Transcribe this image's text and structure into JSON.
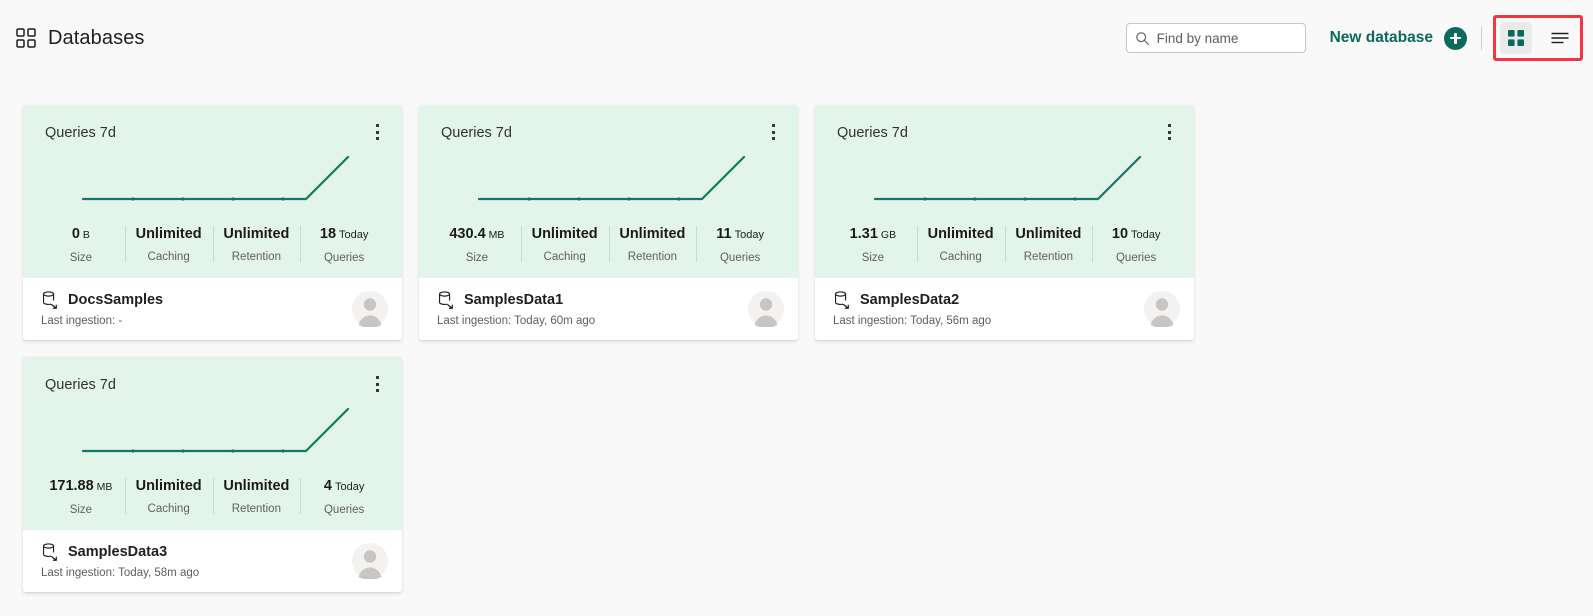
{
  "header": {
    "title": "Databases",
    "title_icon": "grid-apps-icon",
    "search": {
      "placeholder": "Find by name",
      "value": "",
      "icon": "search-icon"
    },
    "new_database": {
      "label": "New database",
      "icon": "plus-circle-icon"
    },
    "view_toggle": {
      "grid": {
        "icon": "grid-view-icon",
        "active": true
      },
      "list": {
        "icon": "list-view-icon",
        "active": false
      },
      "highlight_color": "#f4343e"
    }
  },
  "colors": {
    "accent_green": "#0b6a5b",
    "card_top_bg": "#e3f5ea",
    "spark_line": "#0f7a63",
    "page_bg": "#f8f9f8",
    "highlight_box": "#f4343e"
  },
  "chart_data": {
    "type": "line",
    "title": "Queries 7d",
    "x": [
      0,
      1,
      2,
      3,
      4,
      5,
      6
    ],
    "series": [
      {
        "name": "DocsSamples",
        "values": [
          0,
          0,
          0,
          0,
          0,
          0,
          18
        ]
      },
      {
        "name": "SamplesData1",
        "values": [
          0,
          0,
          0,
          0,
          0,
          0,
          11
        ]
      },
      {
        "name": "SamplesData2",
        "values": [
          0,
          0,
          0,
          0,
          0,
          0,
          10
        ]
      },
      {
        "name": "SamplesData3",
        "values": [
          0,
          0,
          0,
          0,
          0,
          0,
          4
        ]
      }
    ],
    "xlabel": "",
    "ylabel": "",
    "grid": false,
    "legend": "none"
  },
  "cards": [
    {
      "chart_title": "Queries 7d",
      "menu_icon": "kebab-menu-icon",
      "metrics": [
        {
          "value": "0",
          "unit": "B",
          "label": "Size"
        },
        {
          "value": "Unlimited",
          "unit": "",
          "label": "Caching"
        },
        {
          "value": "Unlimited",
          "unit": "",
          "label": "Retention"
        },
        {
          "value": "18",
          "unit": "Today",
          "label": "Queries"
        }
      ],
      "db_name": "DocsSamples",
      "db_icon": "database-icon",
      "last_ingestion": "Last ingestion: -",
      "avatar_icon": "user-avatar-icon"
    },
    {
      "chart_title": "Queries 7d",
      "menu_icon": "kebab-menu-icon",
      "metrics": [
        {
          "value": "430.4",
          "unit": "MB",
          "label": "Size"
        },
        {
          "value": "Unlimited",
          "unit": "",
          "label": "Caching"
        },
        {
          "value": "Unlimited",
          "unit": "",
          "label": "Retention"
        },
        {
          "value": "11",
          "unit": "Today",
          "label": "Queries"
        }
      ],
      "db_name": "SamplesData1",
      "db_icon": "database-icon",
      "last_ingestion": "Last ingestion: Today, 60m ago",
      "avatar_icon": "user-avatar-icon"
    },
    {
      "chart_title": "Queries 7d",
      "menu_icon": "kebab-menu-icon",
      "metrics": [
        {
          "value": "1.31",
          "unit": "GB",
          "label": "Size"
        },
        {
          "value": "Unlimited",
          "unit": "",
          "label": "Caching"
        },
        {
          "value": "Unlimited",
          "unit": "",
          "label": "Retention"
        },
        {
          "value": "10",
          "unit": "Today",
          "label": "Queries"
        }
      ],
      "db_name": "SamplesData2",
      "db_icon": "database-icon",
      "last_ingestion": "Last ingestion: Today, 56m ago",
      "avatar_icon": "user-avatar-icon"
    },
    {
      "chart_title": "Queries 7d",
      "menu_icon": "kebab-menu-icon",
      "metrics": [
        {
          "value": "171.88",
          "unit": "MB",
          "label": "Size"
        },
        {
          "value": "Unlimited",
          "unit": "",
          "label": "Caching"
        },
        {
          "value": "Unlimited",
          "unit": "",
          "label": "Retention"
        },
        {
          "value": "4",
          "unit": "Today",
          "label": "Queries"
        }
      ],
      "db_name": "SamplesData3",
      "db_icon": "database-icon",
      "last_ingestion": "Last ingestion: Today, 58m ago",
      "avatar_icon": "user-avatar-icon"
    }
  ]
}
